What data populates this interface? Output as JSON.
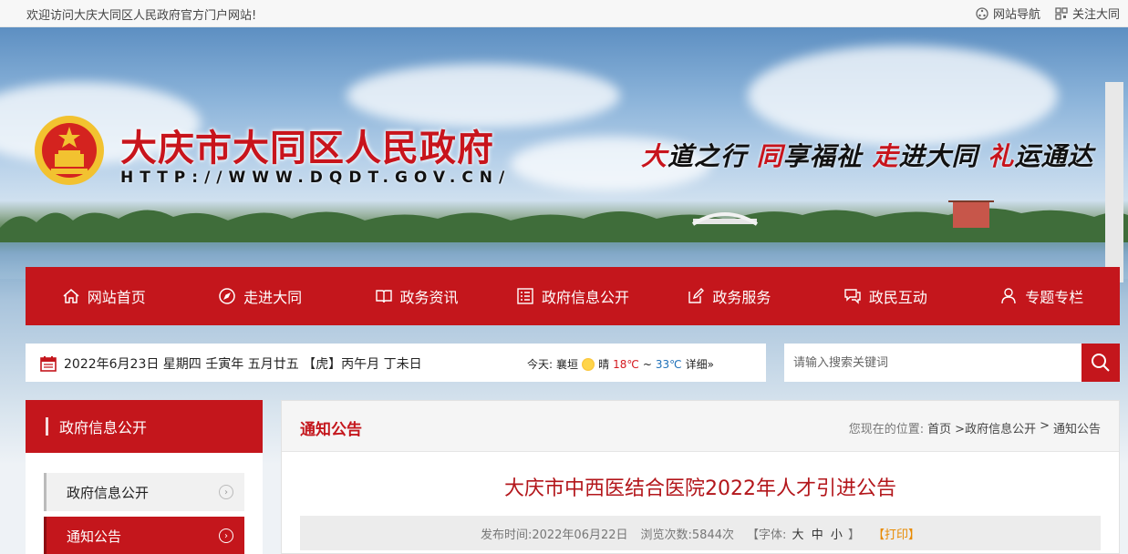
{
  "topbar": {
    "welcome": "欢迎访问大庆大同区人民政府官方门户网站!",
    "links": [
      {
        "label": "网站导航",
        "icon": "sitemap-icon"
      },
      {
        "label": "关注大同",
        "icon": "qrcode-icon"
      }
    ]
  },
  "banner": {
    "title": "大庆市大同区人民政府",
    "url": "HTTP://WWW.DQDT.GOV.CN/",
    "slogan": [
      {
        "lead": "大",
        "rest": "道之行"
      },
      {
        "lead": "同",
        "rest": "享福祉"
      },
      {
        "lead": "走",
        "rest": "进大同"
      },
      {
        "lead": "礼",
        "rest": "运通达"
      }
    ]
  },
  "nav": {
    "items": [
      {
        "label": "网站首页",
        "icon": "home-icon"
      },
      {
        "label": "走进大同",
        "icon": "compass-icon"
      },
      {
        "label": "政务资讯",
        "icon": "book-icon"
      },
      {
        "label": "政府信息公开",
        "icon": "list-icon"
      },
      {
        "label": "政务服务",
        "icon": "edit-icon"
      },
      {
        "label": "政民互动",
        "icon": "chat-icon"
      },
      {
        "label": "专题专栏",
        "icon": "user-icon"
      }
    ]
  },
  "infobar": {
    "date_text": "2022年6月23日 星期四  壬寅年 五月廿五 【虎】丙午月 丁未日",
    "weather_label": "今天:",
    "city": "襄垣",
    "condition": "晴",
    "temp_low": "18℃",
    "temp_sep": "~",
    "temp_high": "33℃",
    "detail": "详细»"
  },
  "search": {
    "placeholder": "请输入搜索关键词"
  },
  "sidebar": {
    "header": "政府信息公开",
    "items": [
      {
        "label": "政府信息公开",
        "active": false
      },
      {
        "label": "通知公告",
        "active": true
      }
    ]
  },
  "main": {
    "section_title": "通知公告",
    "breadcrumb_label": "您现在的位置:",
    "breadcrumb": [
      "首页",
      ">政府信息公开",
      ">",
      "通知公告"
    ],
    "article_title": "大庆市中西医结合医院2022年人才引进公告",
    "meta": {
      "publish_label": "发布时间:",
      "publish_date": "2022年06月22日",
      "views_label": "浏览次数:",
      "views": "5844次",
      "font_label_open": "【字体:",
      "font_sizes": [
        "大",
        "中",
        "小"
      ],
      "font_label_close": "】",
      "print": "【打印】"
    }
  },
  "colors": {
    "brand_red": "#c4161c",
    "title_red": "#b3161b",
    "print_orange": "#e88a00"
  }
}
